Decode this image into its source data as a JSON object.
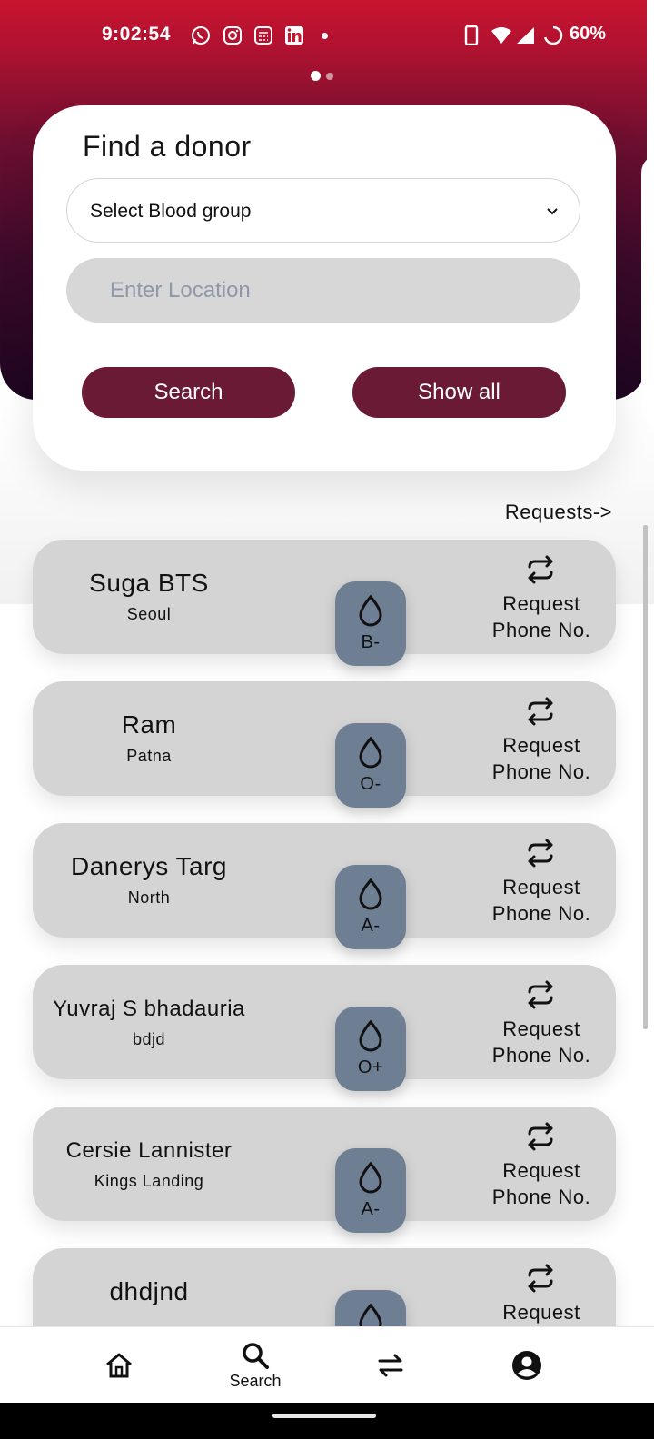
{
  "status_bar": {
    "time": "9:02:54",
    "notification_icons": [
      "whatsapp-icon",
      "instagram-icon",
      "calculator-app-icon",
      "linkedin-icon"
    ],
    "battery_percent": "60%"
  },
  "find_donor": {
    "title": "Find a donor",
    "blood_group_select": "Select Blood group",
    "location_placeholder": "Enter Location",
    "search_label": "Search",
    "show_all_label": "Show all"
  },
  "requests_link": "Requests->",
  "donors": [
    {
      "name": "Suga BTS",
      "location": "Seoul",
      "blood_group": "B-",
      "request_label": "Request Phone No."
    },
    {
      "name": "Ram",
      "location": "Patna",
      "blood_group": "O-",
      "request_label": "Request Phone No."
    },
    {
      "name": "Danerys Targ",
      "location": "North",
      "blood_group": "A-",
      "request_label": "Request Phone No."
    },
    {
      "name": "Yuvraj S bhadauria",
      "location": "bdjd",
      "blood_group": "O+",
      "request_label": "Request Phone No."
    },
    {
      "name": "Cersie Lannister",
      "location": "Kings Landing",
      "blood_group": "A-",
      "request_label": "Request Phone No."
    },
    {
      "name": "dhdjnd",
      "location": "",
      "blood_group": "",
      "request_label": "Request"
    }
  ],
  "bottom_nav": {
    "search_label": "Search"
  },
  "colors": {
    "brand_red": "#c8142f",
    "button_maroon": "#6b1a35",
    "card_grey": "#d4d4d4",
    "badge_slate": "#6e7f93"
  }
}
